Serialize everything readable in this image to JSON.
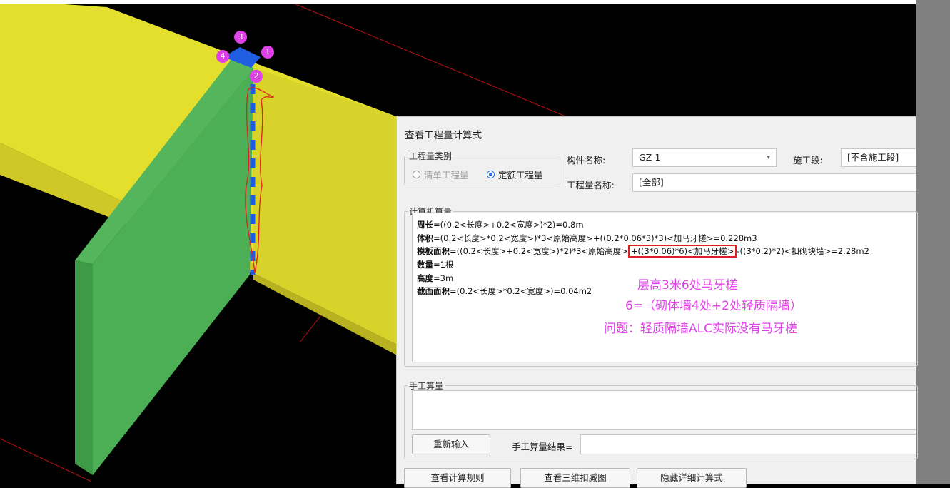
{
  "viewport": {
    "point_labels": [
      "1",
      "2",
      "3",
      "4"
    ],
    "colors": {
      "beam": "#e3df2c",
      "wall": "#4caf55",
      "column": "#1f5ee0",
      "grid_line": "#c01010",
      "label": "#e040e8"
    }
  },
  "dialog": {
    "title": "查看工程量计算式",
    "qty_type": {
      "legend": "工程量类别",
      "options": [
        {
          "label": "清单工程量",
          "checked": false,
          "disabled": true
        },
        {
          "label": "定额工程量",
          "checked": true,
          "disabled": false
        }
      ]
    },
    "component_label": "构件名称:",
    "component_value": "GZ-1",
    "stage_label": "施工段:",
    "stage_value": "[不含施工段]",
    "qty_name_label": "工程量名称:",
    "qty_name_value": "[全部]",
    "computer_calc": {
      "legend": "计算机算量",
      "lines": [
        {
          "name": "周长",
          "expr": "=((0.2<长度>+0.2<宽度>)*2)=0.8m"
        },
        {
          "name": "体积",
          "expr": "=(0.2<长度>*0.2<宽度>)*3<原始高度>+((0.2*0.06*3)*3)<加马牙槎>=0.228m3"
        },
        {
          "name": "模板面积",
          "expr_pre": "=((0.2<长度>+0.2<宽度>)*2)*3<原始高度>",
          "expr_highlight": "+((3*0.06)*6)<加马牙槎>",
          "expr_post": "-((3*0.2)*2)<扣砌块墙>=2.28m2"
        },
        {
          "name": "数量",
          "expr": "=1根"
        },
        {
          "name": "高度",
          "expr": "=3m"
        },
        {
          "name": "截面面积",
          "expr": "=(0.2<长度>*0.2<宽度>)=0.04m2"
        }
      ],
      "annotations": [
        "层高3米6处马牙槎",
        "6=（砌体墙4处+2处轻质隔墙）",
        "问题：轻质隔墙ALC实际没有马牙槎"
      ]
    },
    "manual_calc": {
      "legend": "手工算量",
      "reenter_button": "重新输入",
      "result_label": "手工算量结果="
    },
    "bottom_buttons": [
      "查看计算规则",
      "查看三维扣减图",
      "隐藏详细计算式"
    ]
  }
}
